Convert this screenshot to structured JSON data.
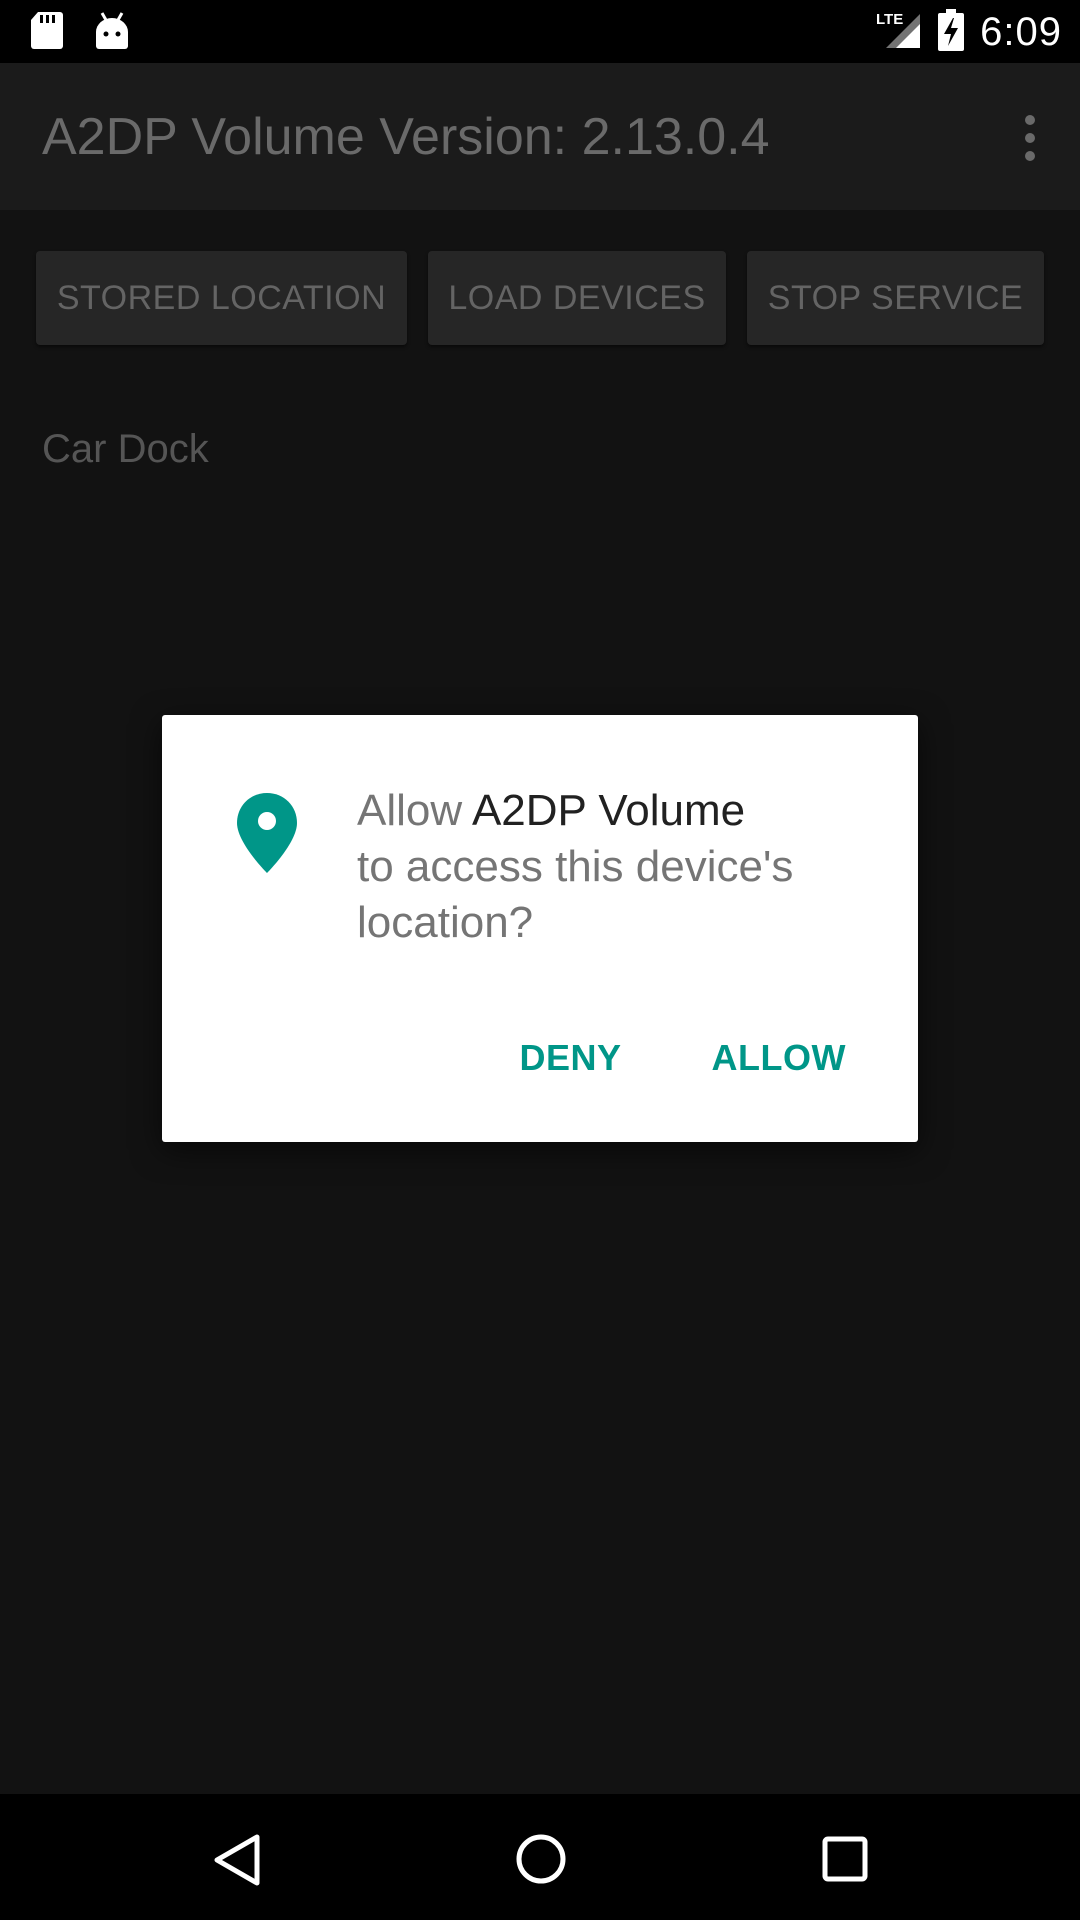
{
  "status_bar": {
    "time": "6:09",
    "network": "LTE",
    "icons": [
      "sd-card-icon",
      "android-icon",
      "lte-signal-icon",
      "battery-charging-icon"
    ]
  },
  "app": {
    "title": "A2DP Volume Version: 2.13.0.4",
    "buttons": {
      "stored_location": "STORED LOCATION",
      "load_devices": "LOAD DEVICES",
      "stop_service": "STOP SERVICE"
    },
    "device_label": "Car Dock"
  },
  "dialog": {
    "prefix": "Allow ",
    "app_name": "A2DP Volume",
    "message_rest": "to access this device's location?",
    "deny_label": "DENY",
    "allow_label": "ALLOW",
    "accent_color": "#009688"
  },
  "nav_bar": {
    "icons": [
      "back-icon",
      "home-icon",
      "recents-icon"
    ]
  }
}
